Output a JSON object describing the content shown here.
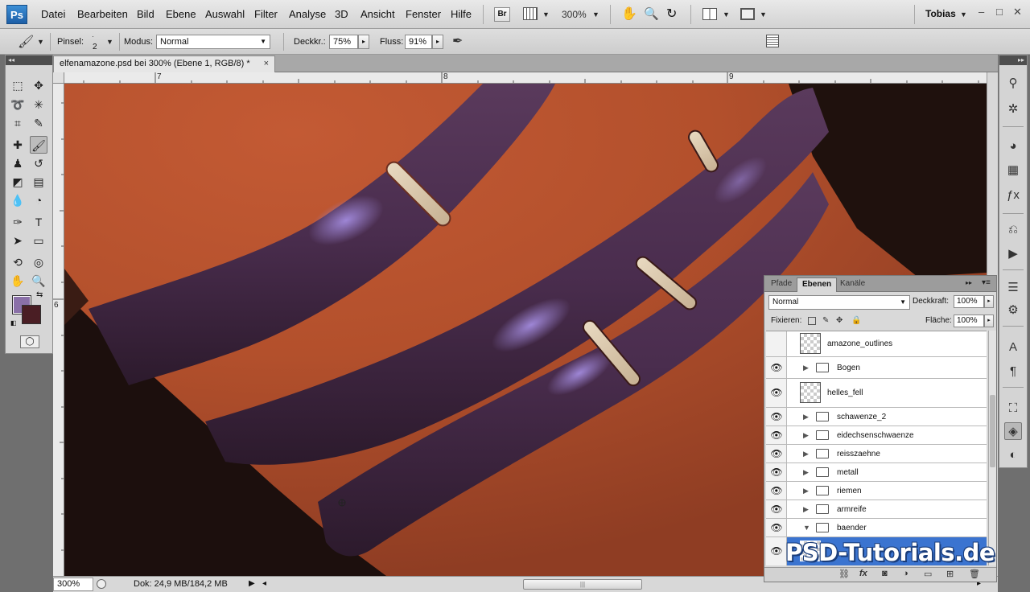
{
  "app": {
    "logo": "Ps"
  },
  "menu": [
    "Datei",
    "Bearbeiten",
    "Bild",
    "Ebene",
    "Auswahl",
    "Filter",
    "Analyse",
    "3D",
    "Ansicht",
    "Fenster",
    "Hilfe"
  ],
  "menubar": {
    "bridge_label": "Br",
    "zoom": "300%",
    "user": "Tobias"
  },
  "options": {
    "brush_label": "Pinsel:",
    "brush_size": "2",
    "mode_label": "Modus:",
    "mode_value": "Normal",
    "opacity_label": "Deckkr.:",
    "opacity_value": "75%",
    "flow_label": "Fluss:",
    "flow_value": "91%"
  },
  "document": {
    "tab_title": "elfenamazone.psd bei 300% (Ebene 1, RGB/8) *",
    "close": "×",
    "ruler_top": [
      "7",
      "8",
      "9"
    ],
    "ruler_left": [
      "6"
    ]
  },
  "status": {
    "zoom": "300%",
    "doc_info": "Dok: 24,9 MB/184,2 MB",
    "scroll_grip": "|||"
  },
  "layers_panel": {
    "tabs": [
      "Pfade",
      "Ebenen",
      "Kanäle"
    ],
    "active_tab": "Ebenen",
    "blend_mode": "Normal",
    "opacity_label": "Deckkraft:",
    "opacity_value": "100%",
    "lock_label": "Fixieren:",
    "fill_label": "Fläche:",
    "fill_value": "100%",
    "layers": [
      {
        "name": "amazone_outlines",
        "type": "layer",
        "visible": false
      },
      {
        "name": "Bogen",
        "type": "group",
        "visible": true,
        "expanded": false
      },
      {
        "name": "helles_fell",
        "type": "layer",
        "visible": true
      },
      {
        "name": "schawenze_2",
        "type": "group",
        "visible": true,
        "expanded": false
      },
      {
        "name": "eidechsenschwaenze",
        "type": "group",
        "visible": true,
        "expanded": false
      },
      {
        "name": "reisszaehne",
        "type": "group",
        "visible": true,
        "expanded": false
      },
      {
        "name": "metall",
        "type": "group",
        "visible": true,
        "expanded": false
      },
      {
        "name": "riemen",
        "type": "group",
        "visible": true,
        "expanded": false
      },
      {
        "name": "armreife",
        "type": "group",
        "visible": true,
        "expanded": false
      },
      {
        "name": "baender",
        "type": "group",
        "visible": true,
        "expanded": true
      },
      {
        "name": "",
        "type": "layer",
        "visible": true,
        "selected": true
      }
    ]
  },
  "colors": {
    "foreground": "#8a70a8",
    "background": "#4a1e24",
    "selection": "#3b74d0"
  },
  "watermark": "PSD-Tutorials.de"
}
